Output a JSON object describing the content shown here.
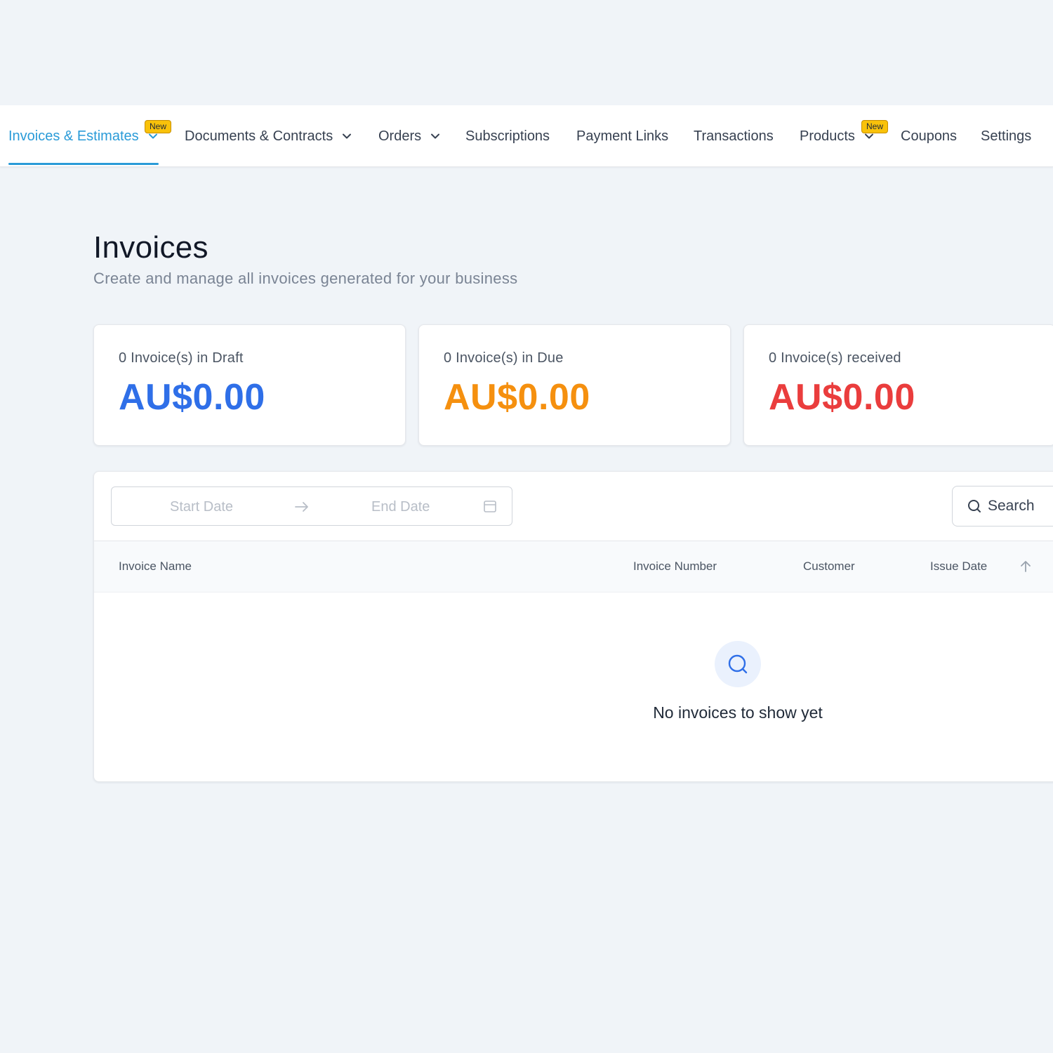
{
  "nav": {
    "items": [
      {
        "label": "Invoices & Estimates",
        "badge": "New",
        "dropdown": true,
        "active": true
      },
      {
        "label": "Documents & Contracts",
        "dropdown": true
      },
      {
        "label": "Orders",
        "dropdown": true
      },
      {
        "label": "Subscriptions"
      },
      {
        "label": "Payment Links"
      },
      {
        "label": "Transactions"
      },
      {
        "label": "Products",
        "badge": "New",
        "dropdown": true
      },
      {
        "label": "Coupons"
      },
      {
        "label": "Settings"
      }
    ],
    "active_color": "#2a9bd8"
  },
  "header": {
    "title": "Invoices",
    "subtitle": "Create and manage all invoices generated for your business"
  },
  "stats": [
    {
      "label": "0 Invoice(s) in Draft",
      "value": "AU$0.00",
      "color": "#2f6fe8"
    },
    {
      "label": "0 Invoice(s) in Due",
      "value": "AU$0.00",
      "color": "#f5900f"
    },
    {
      "label": "0 Invoice(s) received",
      "value": "AU$0.00",
      "color": "#ea3d3d"
    }
  ],
  "filters": {
    "start_placeholder": "Start Date",
    "end_placeholder": "End Date",
    "search_label": "Search"
  },
  "table": {
    "columns": [
      "Invoice Name",
      "Invoice Number",
      "Customer",
      "Issue Date"
    ],
    "empty_message": "No invoices to show yet"
  }
}
